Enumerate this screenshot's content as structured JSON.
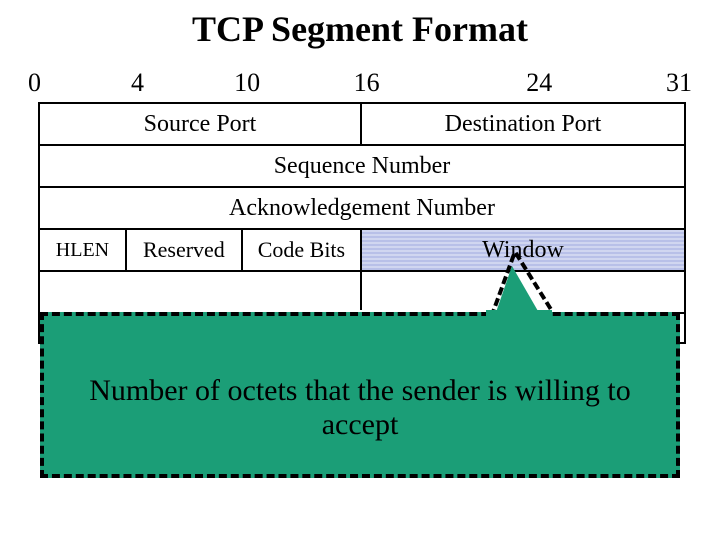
{
  "title": "TCP Segment Format",
  "bits": {
    "b0": "0",
    "b4": "4",
    "b10": "10",
    "b16": "16",
    "b24": "24",
    "b31": "31"
  },
  "fields": {
    "source_port": "Source Port",
    "dest_port": "Destination Port",
    "seq_num": "Sequence Number",
    "ack_num": "Acknowledgement Number",
    "hlen": "HLEN",
    "reserved": "Reserved",
    "code_bits": "Code Bits",
    "window": "Window"
  },
  "callout": "Number of octets that the sender is willing to accept"
}
